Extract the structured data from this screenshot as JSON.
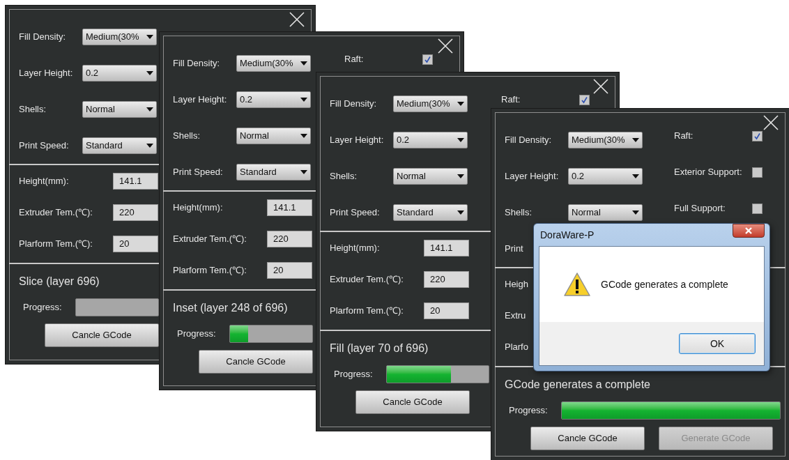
{
  "windows": [
    {
      "settings": [
        {
          "label": "Fill Density:",
          "value": "Medium(30%"
        },
        {
          "label": "Layer Height:",
          "value": "0.2"
        },
        {
          "label": "Shells:",
          "value": "Normal"
        },
        {
          "label": "Print Speed:",
          "value": "Standard"
        }
      ],
      "fields": [
        {
          "label": "Height(mm):",
          "value": "141.1"
        },
        {
          "label": "Extruder Tem.(℃):",
          "value": "220"
        },
        {
          "label": "Plarform Tem.(℃):",
          "value": "20"
        }
      ],
      "status": "Slice (layer 696)",
      "progress": {
        "label": "Progress:",
        "level": 0
      },
      "buttons": [
        {
          "label": "Cancle GCode",
          "disabled": false
        }
      ]
    },
    {
      "settings": [
        {
          "label": "Fill Density:",
          "value": "Medium(30%"
        },
        {
          "label": "Layer Height:",
          "value": "0.2"
        },
        {
          "label": "Shells:",
          "value": "Normal"
        },
        {
          "label": "Print Speed:",
          "value": "Standard"
        }
      ],
      "options": [
        {
          "label": "Raft:",
          "checked": true
        }
      ],
      "fields": [
        {
          "label": "Height(mm):",
          "value": "141.1"
        },
        {
          "label": "Extruder Tem.(℃):",
          "value": "220"
        },
        {
          "label": "Plarform Tem.(℃):",
          "value": "20"
        }
      ],
      "status": "Inset (layer 248 of 696)",
      "progress": {
        "label": "Progress:",
        "level": 0.22
      },
      "buttons": [
        {
          "label": "Cancle GCode",
          "disabled": false
        }
      ]
    },
    {
      "settings": [
        {
          "label": "Fill Density:",
          "value": "Medium(30%"
        },
        {
          "label": "Layer Height:",
          "value": "0.2"
        },
        {
          "label": "Shells:",
          "value": "Normal"
        },
        {
          "label": "Print Speed:",
          "value": "Standard"
        }
      ],
      "options": [
        {
          "label": "Raft:",
          "checked": true
        }
      ],
      "fields": [
        {
          "label": "Height(mm):",
          "value": "141.1"
        },
        {
          "label": "Extruder Tem.(℃):",
          "value": "220"
        },
        {
          "label": "Plarform Tem.(℃):",
          "value": "20"
        }
      ],
      "status": "Fill (layer 70 of 696)",
      "progress": {
        "label": "Progress:",
        "level": 0.63
      },
      "buttons": [
        {
          "label": "Cancle GCode",
          "disabled": false
        }
      ]
    },
    {
      "settings": [
        {
          "label": "Fill Density:",
          "value": "Medium(30%"
        },
        {
          "label": "Layer Height:",
          "value": "0.2"
        },
        {
          "label": "Shells:",
          "value": "Normal"
        },
        {
          "label": "Print"
        }
      ],
      "options": [
        {
          "label": "Raft:",
          "checked": true
        },
        {
          "label": "Exterior Support:",
          "checked": false
        },
        {
          "label": "Full Support:",
          "checked": false
        }
      ],
      "fields": [
        {
          "label": "Heigh"
        },
        {
          "label": "Extru"
        },
        {
          "label": "Plarfo"
        }
      ],
      "status": "GCode generates a complete",
      "progress": {
        "label": "Progress:",
        "level": 1
      },
      "buttons": [
        {
          "label": "Cancle GCode",
          "disabled": false
        },
        {
          "label": "Generate GCode",
          "disabled": true
        }
      ]
    }
  ],
  "dialog": {
    "title": "DoraWare-P",
    "message": "GCode generates a complete",
    "buttons": [
      {
        "label": "OK",
        "default": true
      }
    ]
  }
}
